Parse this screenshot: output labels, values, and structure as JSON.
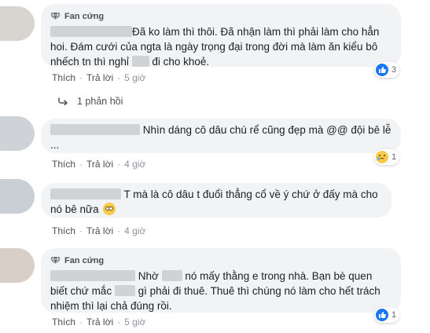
{
  "colors": {
    "bubble": "#f2f3f5",
    "like_blue": "#1877f2",
    "text": "#1c1e21",
    "meta": "#8d949e"
  },
  "comments": [
    {
      "badge": "Fan cứng",
      "text_a": "Đã ko làm thì thôi. Đã nhận làm thì phải làm cho hẳn hoi. Đám cưới của ngta là ngày trọng đại trong đời mà làm ăn kiểu bô nhếch tn thì nghỉ ",
      "text_b": " đi cho khoẻ.",
      "reaction_icon": "like-icon",
      "reaction_count": "3",
      "like": "Thích",
      "reply": "Trả lời",
      "time": "5 giờ"
    },
    {
      "text_a": "Nhìn dáng cô dâu chú rể cũng đẹp mà @@ đội bê lễ ...",
      "reaction_icon": "sad-icon",
      "reaction_count": "1",
      "like": "Thích",
      "reply": "Trả lời",
      "time": "4 giờ"
    },
    {
      "text_a": "T mà là cô dâu t đuổi thẳng cổ về ý chứ ở đấy mà cho nó bê nữa",
      "emoji": "rolling-eyes-emoji",
      "like": "Thích",
      "reply": "Trả lời",
      "time": "4 giờ"
    },
    {
      "badge": "Fan cứng",
      "text_a": "Nhờ ",
      "text_b": " nó mấy thằng e trong nhà. Bạn bè quen biết chứ mắc ",
      "text_c": " gì phải đi thuê. Thuê thì chúng nó làm cho hết trách nhiệm thì lại chả đúng rồi.",
      "reaction_icon": "like-icon",
      "reaction_count": "1",
      "like": "Thích",
      "reply": "Trả lời",
      "time": "5 giờ"
    }
  ],
  "replies_link": "1 phản hồi"
}
